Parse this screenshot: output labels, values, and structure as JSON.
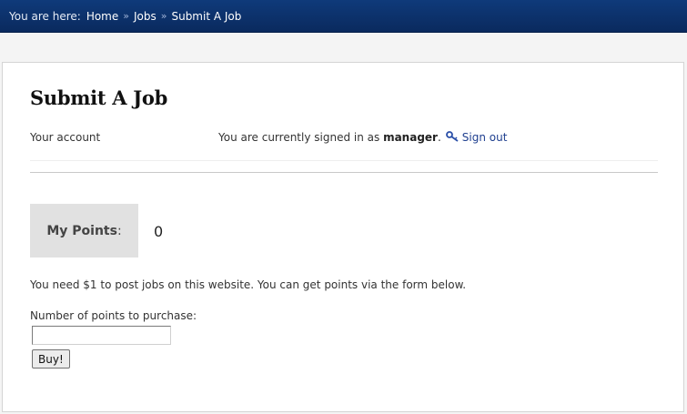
{
  "breadcrumb": {
    "label": "You are here:",
    "items": [
      "Home",
      "Jobs",
      "Submit A Job"
    ],
    "separator": "»"
  },
  "page": {
    "title": "Submit A Job"
  },
  "account": {
    "label": "Your account",
    "status_prefix": "You are currently signed in as",
    "username": "manager",
    "status_suffix": ".",
    "signout_label": "Sign out",
    "signout_icon": "key-icon"
  },
  "points": {
    "label": "My Points",
    "colon": ":",
    "value": "0"
  },
  "purchase": {
    "info_text": "You need $1 to post jobs on this website. You can get points via the form below.",
    "field_label": "Number of points to purchase:",
    "field_value": "",
    "field_placeholder": "",
    "buy_label": "Buy!"
  },
  "colors": {
    "header_bg": "#0f3a7a",
    "link": "#1f3f8f",
    "points_box_bg": "#e1e1e1"
  }
}
